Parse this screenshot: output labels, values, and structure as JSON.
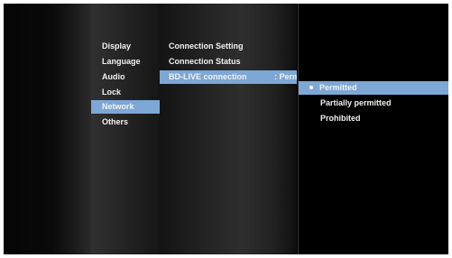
{
  "categories": [
    {
      "label": "Display",
      "selected": false
    },
    {
      "label": "Language",
      "selected": false
    },
    {
      "label": "Audio",
      "selected": false
    },
    {
      "label": "Lock",
      "selected": false
    },
    {
      "label": "Network",
      "selected": true
    },
    {
      "label": "Others",
      "selected": false
    }
  ],
  "submenu": {
    "items": [
      {
        "label": "Connection Setting",
        "value": ""
      },
      {
        "label": "Connection Status",
        "value": ""
      },
      {
        "label": "BD-LIVE connection",
        "value": ": Perm",
        "selected": true
      }
    ]
  },
  "popup": {
    "options": [
      {
        "label": "Permitted",
        "checked": true
      },
      {
        "label": "Partially permitted",
        "checked": false
      },
      {
        "label": "Prohibited",
        "checked": false
      }
    ]
  },
  "colors": {
    "highlight": "#7da7d4",
    "text": "#f2f2f2",
    "background": "#000000"
  }
}
